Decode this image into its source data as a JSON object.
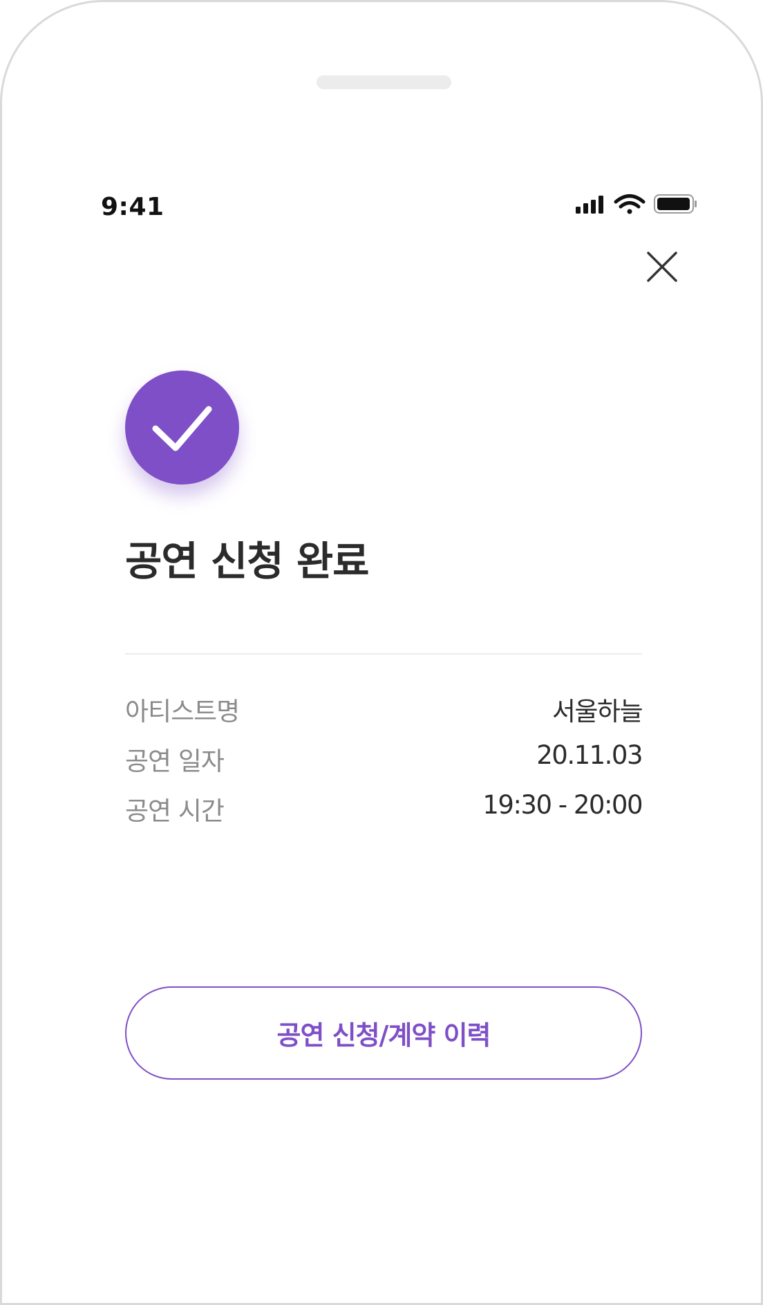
{
  "status_bar": {
    "time": "9:41",
    "icons": [
      "cellular-signal-icon",
      "wifi-icon",
      "battery-icon"
    ]
  },
  "header": {
    "close_icon": "close-icon"
  },
  "result": {
    "icon": "check-icon",
    "title": "공연 신청 완료"
  },
  "details": [
    {
      "label": "아티스트명",
      "value": "서울하늘"
    },
    {
      "label": "공연 일자",
      "value": "20.11.03"
    },
    {
      "label": "공연 시간",
      "value": "19:30 - 20:00"
    }
  ],
  "actions": {
    "history_label": "공연 신청/계약 이력"
  },
  "colors": {
    "accent": "#7e4fc6",
    "title_text": "#2b2b2b",
    "label_text": "#8b8b8b",
    "divider": "#ececec"
  }
}
